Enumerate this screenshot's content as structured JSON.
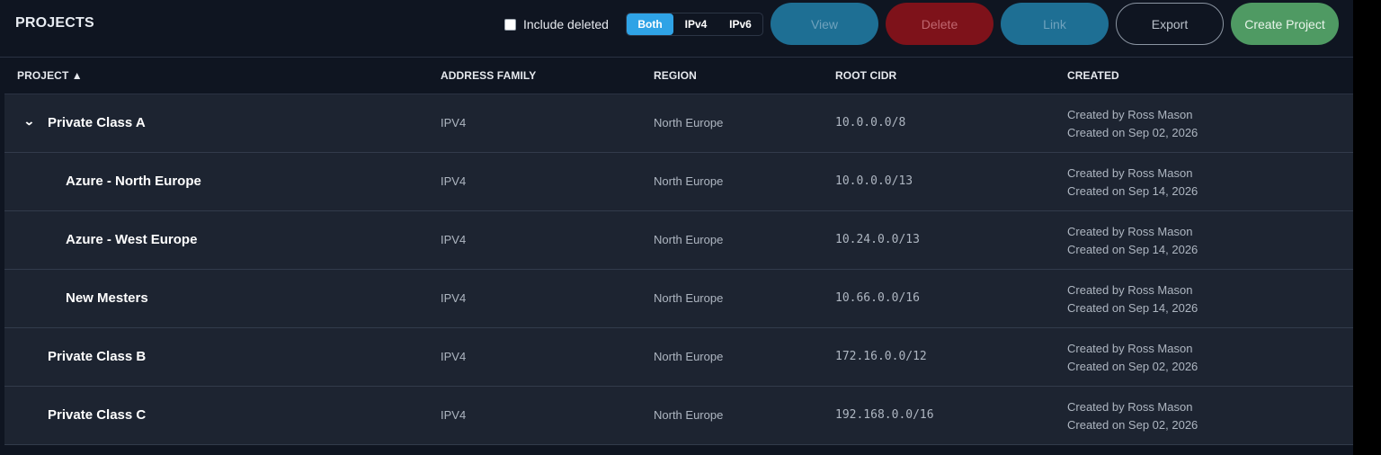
{
  "header": {
    "title": "PROJECTS",
    "include_deleted_label": "Include deleted",
    "include_deleted_checked": false,
    "filters": [
      "Both",
      "IPv4",
      "IPv6"
    ],
    "active_filter": "Both",
    "buttons": {
      "view": "View",
      "delete": "Delete",
      "link": "Link",
      "export": "Export",
      "create": "Create Project"
    }
  },
  "table": {
    "columns": {
      "project": "PROJECT ▲",
      "address_family": "ADDRESS FAMILY",
      "region": "REGION",
      "root_cidr": "ROOT CIDR",
      "created": "CREATED"
    },
    "rows": [
      {
        "name": "Private Class A",
        "family": "IPV4",
        "region": "North Europe",
        "cidr": "10.0.0.0/8",
        "created_by": "Created by Ross Mason",
        "created_on": "Created on Sep 02, 2026"
      },
      {
        "name": "Azure - North Europe",
        "family": "IPV4",
        "region": "North Europe",
        "cidr": "10.0.0.0/13",
        "created_by": "Created by Ross Mason",
        "created_on": "Created on Sep 14, 2026"
      },
      {
        "name": "Azure - West Europe",
        "family": "IPV4",
        "region": "North Europe",
        "cidr": "10.24.0.0/13",
        "created_by": "Created by Ross Mason",
        "created_on": "Created on Sep 14, 2026"
      },
      {
        "name": "New Mesters",
        "family": "IPV4",
        "region": "North Europe",
        "cidr": "10.66.0.0/16",
        "created_by": "Created by Ross Mason",
        "created_on": "Created on Sep 14, 2026"
      },
      {
        "name": "Private Class B",
        "family": "IPV4",
        "region": "North Europe",
        "cidr": "172.16.0.0/12",
        "created_by": "Created by Ross Mason",
        "created_on": "Created on Sep 02, 2026"
      },
      {
        "name": "Private Class C",
        "family": "IPV4",
        "region": "North Europe",
        "cidr": "192.168.0.0/16",
        "created_by": "Created by Ross Mason",
        "created_on": "Created on Sep 02, 2026"
      }
    ]
  },
  "colors": {
    "background": "#0f1521",
    "row": "#1d2431",
    "accent": "#2fa3e6",
    "danger": "#7e121a",
    "success": "#4f9a63"
  }
}
